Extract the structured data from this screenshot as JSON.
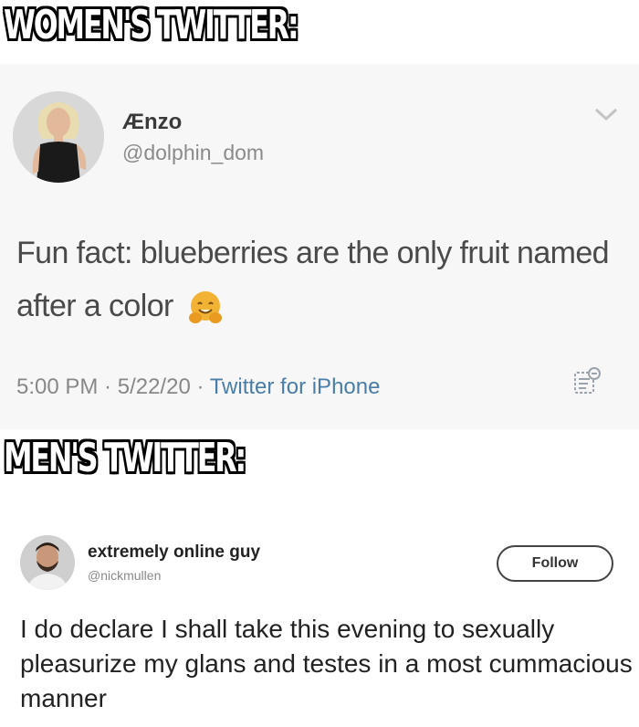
{
  "captions": {
    "top": "WOMEN'S TWITTER:",
    "middle": "MEN'S TWITTER:"
  },
  "tweet_women": {
    "display_name": "Ænzo",
    "handle": "@dolphin_dom",
    "text": "Fun fact: blueberries are the only fruit named after a color",
    "emoji": "hugging-face-icon",
    "time": "5:00 PM",
    "date": "5/22/20",
    "source": "Twitter for iPhone",
    "separator": " · "
  },
  "tweet_men": {
    "display_name": "extremely online guy",
    "handle": "@nickmullen",
    "follow_label": "Follow",
    "text": "I do declare I shall take this evening to sexually pleasurize my glans and testes in a most cummacious manner"
  },
  "colors": {
    "source_link": "#4a7da8",
    "tweet1_bg": "#f7f7f7",
    "emoji": "#f2b233"
  }
}
